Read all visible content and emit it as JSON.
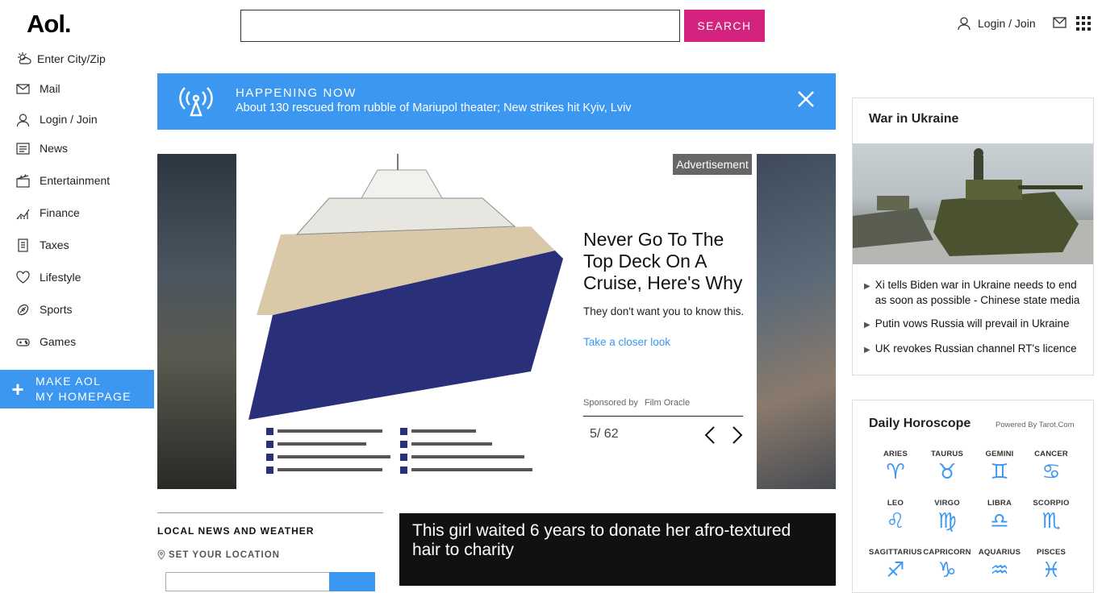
{
  "header": {
    "logo": "Aol.",
    "search_button": "SEARCH",
    "login_label": "Login / Join"
  },
  "sidebar": {
    "weather_label": "Enter City/Zip",
    "items": [
      {
        "label": "Mail",
        "icon": "mail-icon"
      },
      {
        "label": "Login / Join",
        "icon": "user-icon"
      },
      {
        "label": "News",
        "icon": "news-icon"
      },
      {
        "label": "Entertainment",
        "icon": "clapper-icon"
      },
      {
        "label": "Finance",
        "icon": "chart-icon"
      },
      {
        "label": "Taxes",
        "icon": "document-icon"
      },
      {
        "label": "Lifestyle",
        "icon": "heart-icon"
      },
      {
        "label": "Sports",
        "icon": "ball-icon"
      },
      {
        "label": "Games",
        "icon": "gamepad-icon"
      }
    ],
    "make_homepage_line1": "MAKE AOL",
    "make_homepage_line2": "MY HOMEPAGE"
  },
  "happening": {
    "label": "HAPPENING NOW",
    "headline": "About 130 rescued from rubble of Mariupol theater; New strikes hit Kyiv, Lviv"
  },
  "carousel": {
    "ad_badge": "Advertisement",
    "title": "Never Go To The Top Deck On A Cruise, Here's Why",
    "body": "They don't want you to know this.",
    "link": "Take a closer look",
    "sponsored_by": "Sponsored by",
    "sponsor": "Film Oracle",
    "counter": "5/ 62"
  },
  "local": {
    "title": "LOCAL NEWS AND WEATHER",
    "set_location": "SET YOUR LOCATION"
  },
  "video": {
    "title": "This girl waited 6 years to donate her afro-textured hair to charity"
  },
  "war": {
    "title": "War in Ukraine",
    "items": [
      "Xi tells Biden war in Ukraine needs to end as soon as possible - Chinese state media",
      "Putin vows Russia will prevail in Ukraine",
      "UK revokes Russian channel RT's licence"
    ]
  },
  "horoscope": {
    "title": "Daily Horoscope",
    "powered_by": "Powered By Tarot.Com",
    "signs": [
      {
        "name": "ARIES",
        "glyph": "♈"
      },
      {
        "name": "TAURUS",
        "glyph": "♉"
      },
      {
        "name": "GEMINI",
        "glyph": "♊"
      },
      {
        "name": "CANCER",
        "glyph": "♋"
      },
      {
        "name": "LEO",
        "glyph": "♌"
      },
      {
        "name": "VIRGO",
        "glyph": "♍"
      },
      {
        "name": "LIBRA",
        "glyph": "♎"
      },
      {
        "name": "SCORPIO",
        "glyph": "♏"
      },
      {
        "name": "SAGITTARIUS",
        "glyph": "♐"
      },
      {
        "name": "CAPRICORN",
        "glyph": "♑"
      },
      {
        "name": "AQUARIUS",
        "glyph": "♒"
      },
      {
        "name": "PISCES",
        "glyph": "♓"
      }
    ]
  },
  "colors": {
    "accent_blue": "#3b97f0",
    "search_pink": "#d4237f"
  }
}
